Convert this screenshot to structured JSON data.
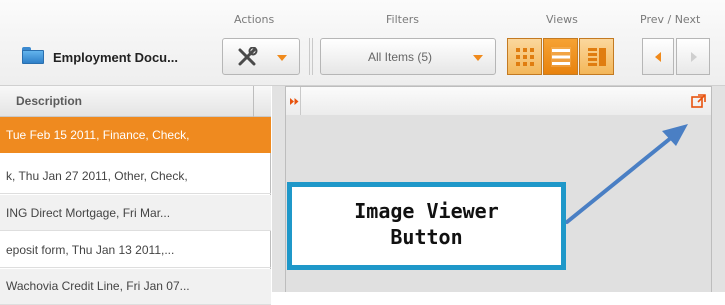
{
  "toolbar": {
    "group_labels": {
      "actions": "Actions",
      "filters": "Filters",
      "views": "Views",
      "prev_next": "Prev / Next"
    },
    "folder_title": "Employment Docu...",
    "filter_value": "All Items (5)",
    "icons": {
      "folder": "folder-icon",
      "actions": "tools-icon",
      "views": [
        "grid-view-icon",
        "list-view-icon",
        "detail-view-icon"
      ],
      "prev": "chevron-left-icon",
      "next": "chevron-right-icon"
    },
    "active_view": "list"
  },
  "list": {
    "header": "Description",
    "rows": [
      {
        "text": "Tue Feb 15 2011, Finance, Check,",
        "selected": true
      },
      {
        "text": "k, Thu Jan 27 2011, Other, Check,",
        "selected": false
      },
      {
        "text": "ING Direct Mortgage, Fri Mar...",
        "selected": false
      },
      {
        "text": "eposit form, Thu Jan 13 2011,...",
        "selected": false
      },
      {
        "text": "Wachovia Credit Line, Fri Jan 07...",
        "selected": false
      }
    ]
  },
  "viewer": {
    "expand_icon": "double-chevron-right-icon",
    "popout_icon": "popout-icon"
  },
  "callout": {
    "line1": "Image Viewer",
    "line2": "Button"
  },
  "colors": {
    "accent": "#ef8a1f",
    "callout_border": "#1f98c9",
    "arrow": "#4a7fc4"
  }
}
